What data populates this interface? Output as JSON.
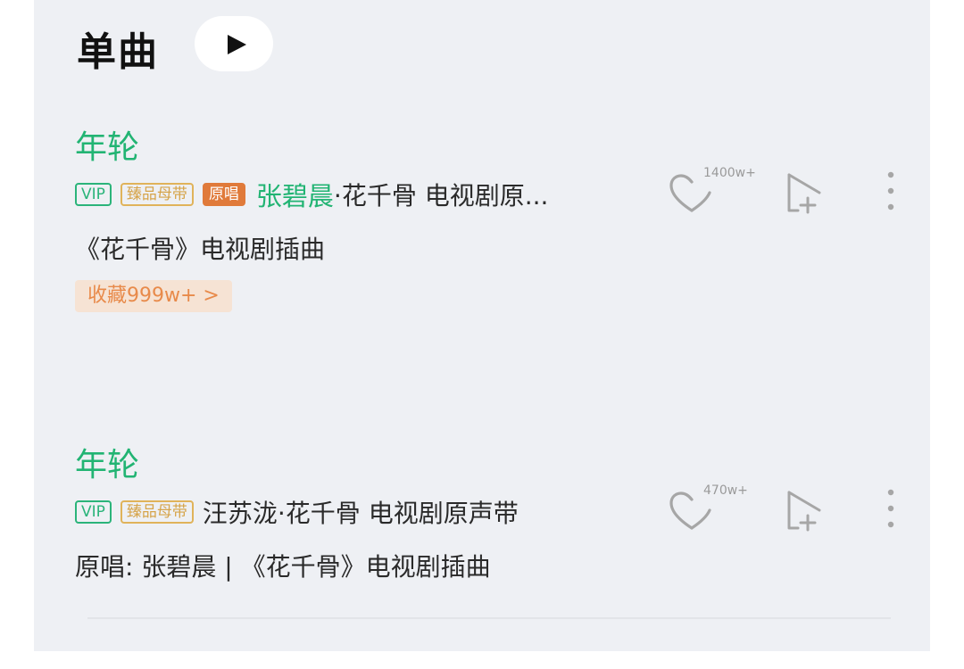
{
  "section": {
    "title": "单曲"
  },
  "colors": {
    "accent": "#22b473",
    "vip": "#2bb47a",
    "master": "#d6a44a",
    "original": "#e07a3a",
    "panel_bg": "#eef0f4"
  },
  "songs": [
    {
      "title": "年轮",
      "tags": [
        "VIP",
        "臻品母带",
        "原唱"
      ],
      "artist_highlight": "张碧晨",
      "artist_rest": "·花千骨 电视剧原...",
      "description": "《花千骨》电视剧插曲",
      "favorite_badge": "收藏999w+ >",
      "like_count": "1400w+",
      "icons": [
        "heart-icon",
        "add-to-playlist-icon",
        "more-icon"
      ]
    },
    {
      "title": "年轮",
      "tags": [
        "VIP",
        "臻品母带"
      ],
      "artist_rest": "汪苏泷·花千骨 电视剧原声带",
      "description": "原唱: 张碧晨 | 《花千骨》电视剧插曲",
      "like_count": "470w+",
      "icons": [
        "heart-icon",
        "add-to-playlist-icon",
        "more-icon"
      ]
    }
  ]
}
